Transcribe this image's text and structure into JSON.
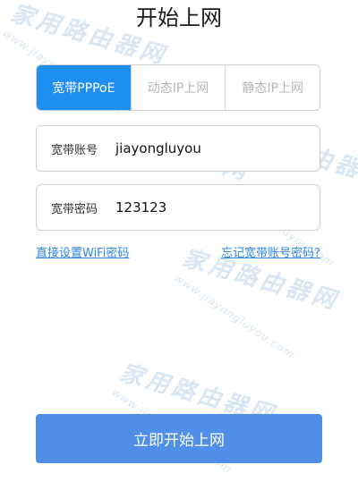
{
  "page": {
    "title": "开始上网"
  },
  "tabs": [
    {
      "label": "宽带PPPoE",
      "active": true
    },
    {
      "label": "动态IP上网",
      "active": false
    },
    {
      "label": "静态IP上网",
      "active": false
    }
  ],
  "form": {
    "username": {
      "label": "宽带账号",
      "value": "jiayongluyou"
    },
    "password": {
      "label": "宽带密码",
      "value": "123123"
    }
  },
  "links": {
    "wifi": "直接设置WiFi密码",
    "forgot": "忘记宽带账号密码?"
  },
  "submit": {
    "label": "立即开始上网"
  },
  "watermark": {
    "logo_text": "家用路由器网",
    "url": "www.jiayongluyou.com"
  },
  "colors": {
    "accent": "#1e8ff0",
    "button": "#4f8fe7",
    "link": "#2b86e4"
  }
}
